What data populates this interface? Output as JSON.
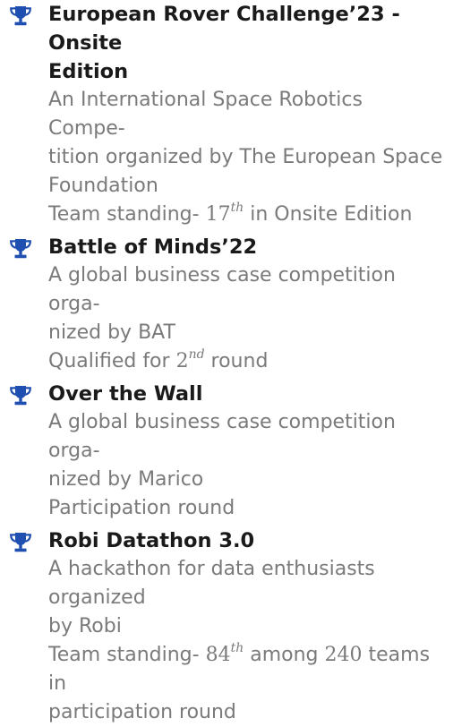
{
  "accent_color": "#1f4fb0",
  "icon": "trophy-icon",
  "entries": [
    {
      "title_lines": [
        "European Rover Challenge’23 - Onsite",
        "Edition"
      ],
      "desc_lines": [
        "An International Space Robotics Compe-",
        "tition organized by The European Space",
        "Foundation"
      ],
      "result": {
        "prefix": "Team standing- ",
        "num": "17",
        "sup": "th",
        "suffix": " in Onsite Edition"
      }
    },
    {
      "title_lines": [
        "Battle of Minds’22"
      ],
      "desc_lines": [
        "A global business case competition orga-",
        "nized by BAT"
      ],
      "result": {
        "prefix": "Qualified for ",
        "num": "2",
        "sup": "nd",
        "suffix": " round"
      }
    },
    {
      "title_lines": [
        "Over the Wall"
      ],
      "desc_lines": [
        "A global business case competition orga-",
        "nized by Marico",
        "Participation round"
      ]
    },
    {
      "title_lines": [
        "Robi Datathon 3.0"
      ],
      "desc_lines": [
        "A hackathon for data enthusiasts organized",
        "by Robi"
      ],
      "result": {
        "prefix": "Team standing- ",
        "num": "84",
        "sup": "th",
        "suffix": " among ",
        "num2": "240",
        "suffix2": " teams in"
      },
      "extra_line": "participation round"
    }
  ]
}
